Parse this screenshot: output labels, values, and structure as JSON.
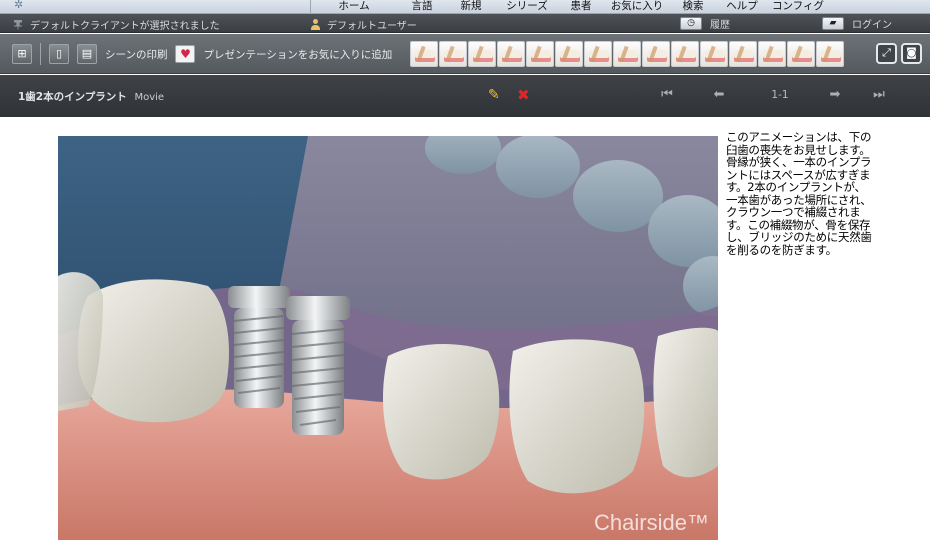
{
  "menu": {
    "items": [
      "ホーム",
      "言語",
      "新規",
      "シリーズ",
      "患者",
      "お気に入り",
      "検索",
      "ヘルプ",
      "コンフィグ"
    ]
  },
  "status": {
    "client": "デフォルトクライアントが選択されました",
    "user": "デフォルトユーザー",
    "history": "履歴",
    "login": "ログイン"
  },
  "toolbar": {
    "print_label": "シーンの印刷",
    "favorite_label": "プレゼンテーションをお気に入りに追加",
    "thumbnail_count": 15
  },
  "titlebar": {
    "title": "1歯2本のインプラント",
    "type": "Movie",
    "page": "1-1"
  },
  "media": {
    "watermark": "Chairside™"
  },
  "description": "このアニメーションは、下の臼歯の喪失をお見せします。骨縁が狭く、一本のインプラントにはスペースが広すぎます。2本のインプラントが、一本歯があった場所にされ、クラウン一つで補綴されます。この補綴物が、骨を保存し、ブリッジのために天然歯を削るのを防ぎます。"
}
